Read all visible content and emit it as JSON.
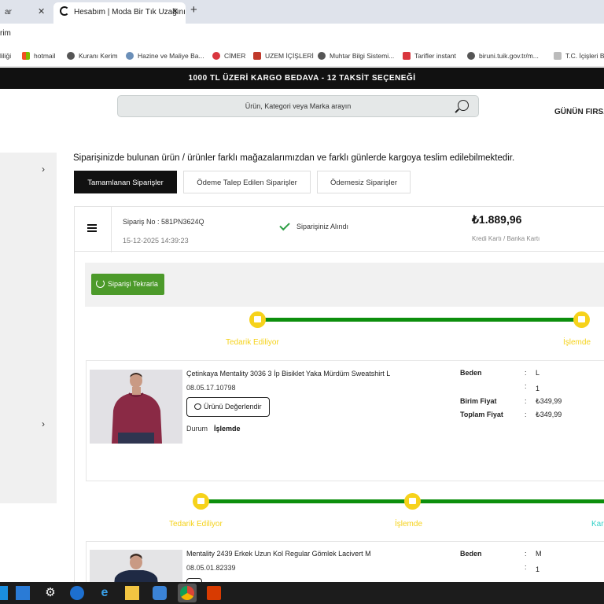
{
  "browser": {
    "tabs": [
      {
        "label": "ar",
        "close": "✕"
      },
      {
        "label": "Hesabım | Moda Bir Tık Uzağınız",
        "close": "✕"
      }
    ],
    "new_tab": "+",
    "address": "rim",
    "bookmarks": [
      {
        "label": "liliği",
        "icon": "bookmark-icon",
        "color": "#888888"
      },
      {
        "label": "hotmail",
        "icon": "windows-icon",
        "color": "#f25022"
      },
      {
        "label": "Kuranı Kerim",
        "icon": "globe-icon",
        "color": "#555555"
      },
      {
        "label": "Hazine ve Maliye Ba...",
        "icon": "seal-icon",
        "color": "#6b8fb8"
      },
      {
        "label": "CİMER",
        "icon": "cimer-icon",
        "color": "#d9363e"
      },
      {
        "label": "UZEM İÇİŞLERİ",
        "icon": "uzem-icon",
        "color": "#c0392b"
      },
      {
        "label": "Muhtar Bilgi Sistemi...",
        "icon": "globe-icon",
        "color": "#555555"
      },
      {
        "label": "Tarifler instant",
        "icon": "recipe-icon",
        "color": "#d9363e"
      },
      {
        "label": "biruni.tuik.gov.tr/m...",
        "icon": "globe-icon",
        "color": "#555555"
      },
      {
        "label": "T.C. İçişleri Ba",
        "icon": "document-icon",
        "color": "#999999"
      }
    ]
  },
  "site": {
    "promo": "1000 TL ÜZERİ KARGO BEDAVA - 12 TAKSİT SEÇENEĞİ",
    "search_placeholder": "Ürün, Kategori veya Marka arayın",
    "gunun_firsati": "GÜNÜN FIRSA",
    "sidebar_chevron": "›"
  },
  "orders": {
    "notice": "Siparişinizde bulunan ürün / ürünler farklı mağazalarımızdan ve farklı günlerde kargoya teslim edilebilmektedir.",
    "tabs": [
      "Tamamlanan Siparişler",
      "Ödeme Talep Edilen Siparişler",
      "Ödemesiz Siparişler"
    ],
    "order": {
      "number": "Sipariş No : 581PN3624Q",
      "date": "15-12-2025 14:39:23",
      "status": "Siparişiniz Alındı",
      "price": "₺1.889,96",
      "payment": "Kredi Kartı / Banka Kartı",
      "repeat_label": "Siparişi Tekrarla"
    },
    "tracker1": {
      "steps": [
        "Tedarik Ediliyor",
        "İşlemde"
      ],
      "progress": 1.0
    },
    "tracker2": {
      "steps": [
        "Tedarik Ediliyor",
        "İşlemde",
        "Kar"
      ]
    },
    "products": [
      {
        "name": "Çetinkaya Mentality 3036 3 İp Bisiklet Yaka Mürdüm Sweatshirt L",
        "code": "08.05.17.10798",
        "rate_label": "Ürünü Değerlendir",
        "status_label": "Durum",
        "status": "İşlemde",
        "specs": [
          {
            "key": "Beden",
            "sep": ":",
            "value": "L"
          },
          {
            "key": "",
            "sep": ":",
            "value": "1"
          },
          {
            "key": "Birim Fiyat",
            "sep": ":",
            "value": "₺349,99"
          },
          {
            "key": "Toplam Fiyat",
            "sep": ":",
            "value": "₺349,99"
          }
        ]
      },
      {
        "name": "Mentality 2439 Erkek Uzun Kol Regular Gömlek Lacivert M",
        "code": "08.05.01.82339",
        "specs": [
          {
            "key": "Beden",
            "sep": ":",
            "value": "M"
          },
          {
            "key": "",
            "sep": ":",
            "value": "1"
          }
        ]
      }
    ]
  },
  "taskbar": {
    "icons": [
      "windows-start-icon",
      "task-view-icon",
      "settings-icon",
      "edge-icon",
      "ie-icon",
      "file-explorer-icon",
      "remote-desktop-icon",
      "chrome-icon",
      "office-icon"
    ]
  }
}
